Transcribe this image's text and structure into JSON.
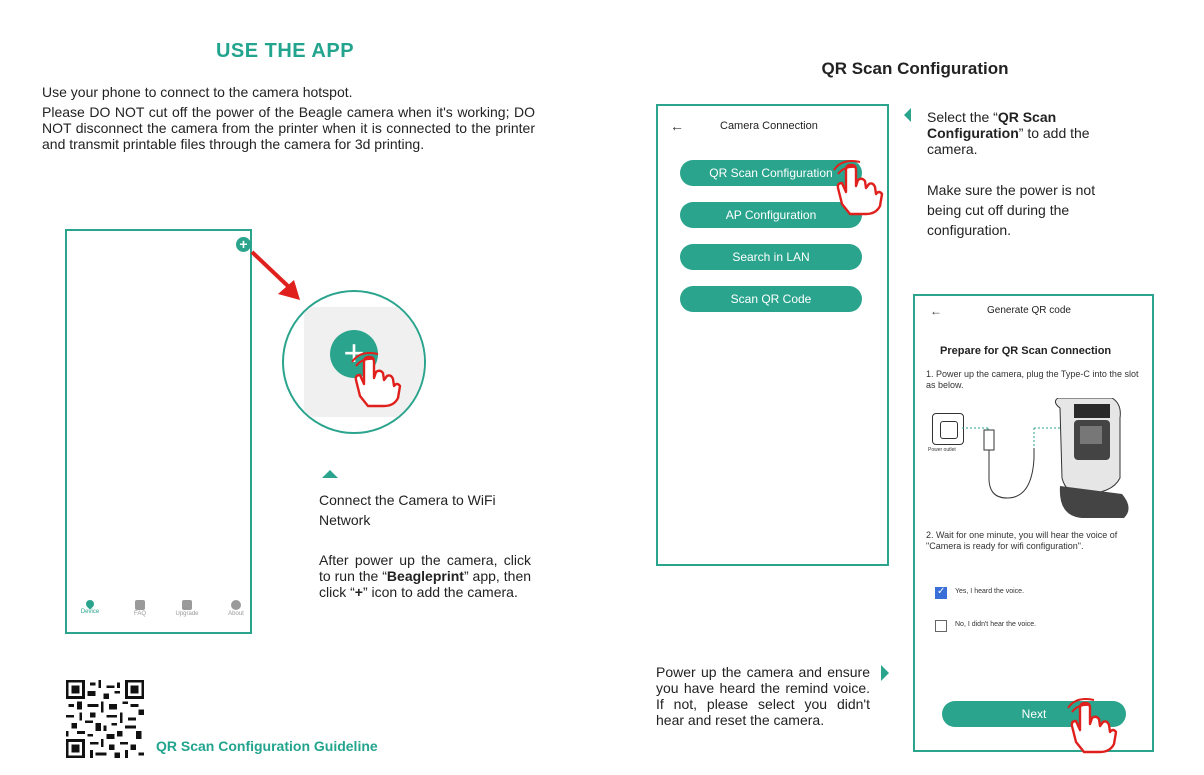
{
  "left": {
    "heading": "USE THE APP",
    "intro": "Use your phone to connect to the camera hotspot.",
    "warning": "Please DO NOT cut off the power of the Beagle camera when it's working; DO NOT disconnect the camera from the printer when it is connected to the printer and transmit printable files through the camera for 3d printing.",
    "tabs": [
      "Device",
      "FAQ",
      "Upgrade",
      "About"
    ],
    "wifi_title": "Connect the Camera to WiFi Network",
    "after_text_1": "After power up the camera, click to run the “",
    "after_bold_1": "Beagleprint",
    "after_text_2": "” app, then click “",
    "after_bold_2": "+",
    "after_text_3": "” icon to add the camera.",
    "qr_label": "QR Scan Configuration Guideline"
  },
  "right": {
    "heading": "QR Scan Configuration",
    "phone_title": "Camera Connection",
    "buttons": [
      "QR Scan Configuration",
      "AP Configuration",
      "Search in LAN",
      "Scan QR Code"
    ],
    "select_text_1": "Select the “",
    "select_bold": "QR Scan Configuration",
    "select_text_2": "” to add the camera.",
    "make_sure": "Make sure the power is not being cut off during the configuration.",
    "qr_phone": {
      "title": "Generate QR code",
      "heading": "Prepare for QR Scan Connection",
      "step1": "1. Power up the camera, plug the Type-C into the slot as below.",
      "outlet_label": "Power outlet",
      "step2": "2. Wait for one minute, you will hear the voice of \"Camera is ready for wifi configuration\".",
      "option_yes": "Yes, I heard the voice.",
      "option_no": "No, I didn't hear the voice.",
      "next": "Next"
    },
    "power_text": "Power up the camera and ensure you have heard the remind voice. If not, please select you didn't hear and reset the camera."
  },
  "colors": {
    "accent": "#2aa48d",
    "heading": "#23a48e",
    "arrow_red": "#e0201c",
    "check": "#3a6fd8"
  }
}
